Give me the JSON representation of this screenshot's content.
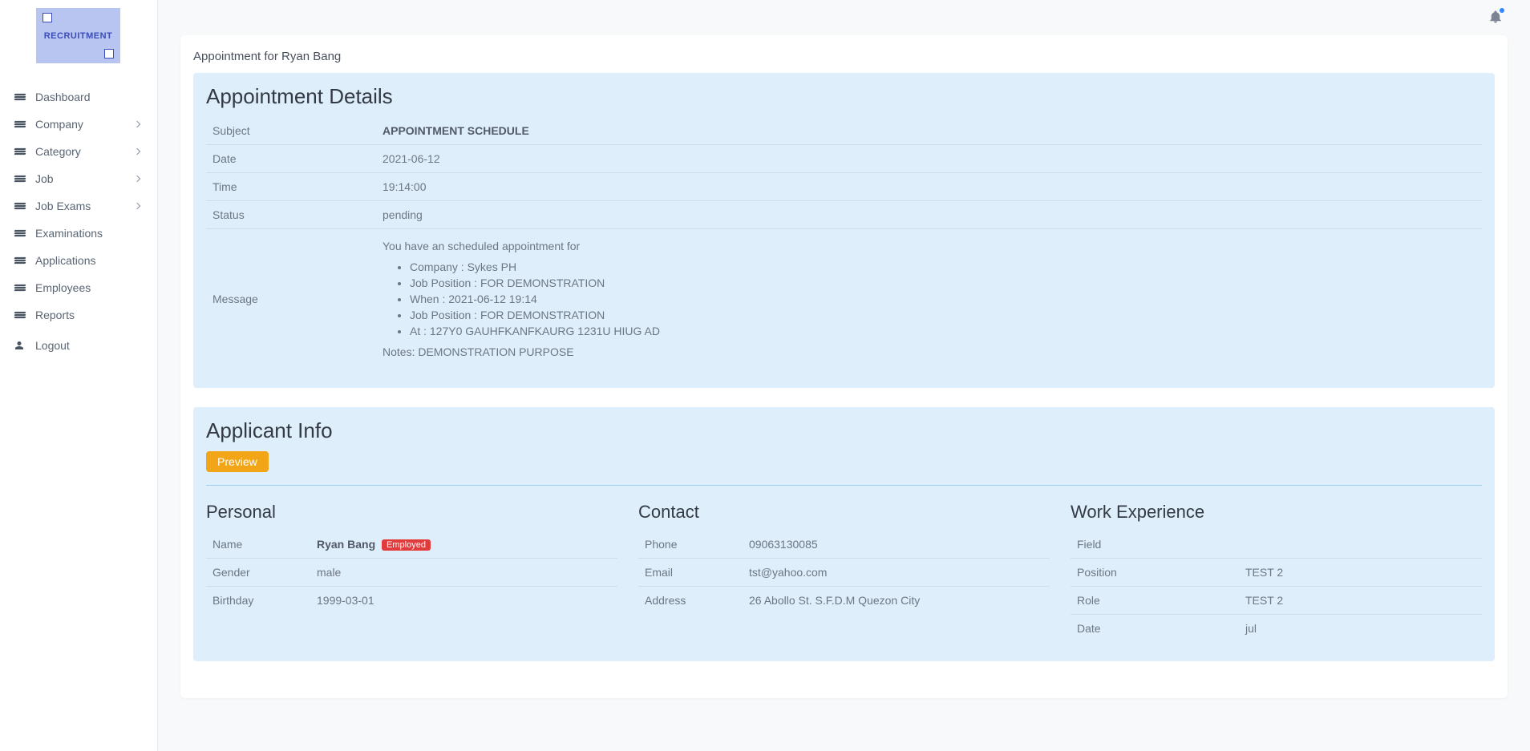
{
  "logo_text": "RECRUITMENT",
  "sidebar": {
    "items": [
      {
        "label": "Dashboard",
        "expandable": false
      },
      {
        "label": "Company",
        "expandable": true
      },
      {
        "label": "Category",
        "expandable": true
      },
      {
        "label": "Job",
        "expandable": true
      },
      {
        "label": "Job Exams",
        "expandable": true
      },
      {
        "label": "Examinations",
        "expandable": false
      },
      {
        "label": "Applications",
        "expandable": false
      },
      {
        "label": "Employees",
        "expandable": false
      },
      {
        "label": "Reports",
        "expandable": false
      }
    ],
    "logout_label": "Logout"
  },
  "page_title": "Appointment for Ryan Bang",
  "appointment": {
    "heading": "Appointment Details",
    "labels": {
      "subject": "Subject",
      "date": "Date",
      "time": "Time",
      "status": "Status",
      "message": "Message"
    },
    "subject": "APPOINTMENT SCHEDULE",
    "date": "2021-06-12",
    "time": "19:14:00",
    "status": "pending",
    "message": {
      "intro": "You have an scheduled appointment for",
      "bullets": [
        "Company : Sykes PH",
        "Job Position : FOR DEMONSTRATION",
        "When : 2021-06-12 19:14",
        "Job Position : FOR DEMONSTRATION",
        "At : 127Y0 GAUHFKANFKAURG 1231U HIUG AD"
      ],
      "notes": "Notes: DEMONSTRATION PURPOSE"
    }
  },
  "applicant": {
    "heading": "Applicant Info",
    "preview_label": "Preview",
    "personal": {
      "heading": "Personal",
      "labels": {
        "name": "Name",
        "gender": "Gender",
        "birthday": "Birthday"
      },
      "name": "Ryan Bang",
      "employment_badge": "Employed",
      "gender": "male",
      "birthday": "1999-03-01"
    },
    "contact": {
      "heading": "Contact",
      "labels": {
        "phone": "Phone",
        "email": "Email",
        "address": "Address"
      },
      "phone": "09063130085",
      "email": "tst@yahoo.com",
      "address": "26 Abollo St. S.F.D.M Quezon City"
    },
    "work": {
      "heading": "Work Experience",
      "labels": {
        "field": "Field",
        "position": "Position",
        "role": "Role",
        "date": "Date"
      },
      "field": "",
      "position": "TEST 2",
      "role": "TEST 2",
      "date": "jul"
    }
  }
}
